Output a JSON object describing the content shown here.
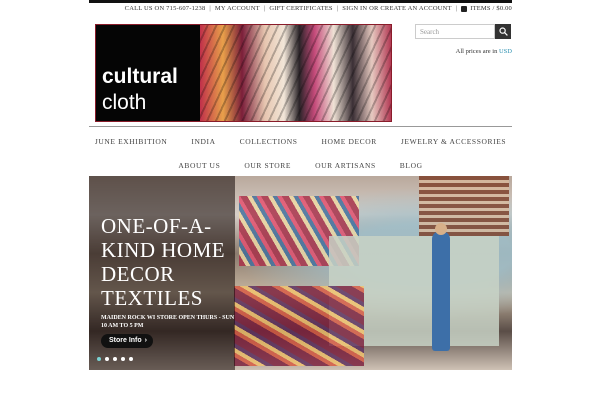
{
  "utility": {
    "phone": "CALL US ON 715-607-1238",
    "account": "MY ACCOUNT",
    "gift": "GIFT CERTIFICATES",
    "signin": "SIGN IN OR CREATE AN ACCOUNT",
    "cart": "ITEMS / $0.00"
  },
  "logo": {
    "line1": "cultural",
    "line2": "cloth"
  },
  "search": {
    "placeholder": "Search"
  },
  "prices": {
    "prefix": "All prices are in",
    "currency": "USD"
  },
  "nav": {
    "row1": [
      "JUNE EXHIBITION",
      "INDIA",
      "COLLECTIONS",
      "HOME DECOR",
      "JEWELRY & ACCESSORIES"
    ],
    "row2": [
      "ABOUT US",
      "OUR STORE",
      "OUR ARTISANS",
      "BLOG"
    ]
  },
  "hero": {
    "heading": "ONE-OF-A-KIND HOME DECOR TEXTILES",
    "sub": "MAIDEN ROCK WI STORE OPEN THURS - SUN 10 AM TO 5 PM",
    "button": "Store Info",
    "slides_total": 5,
    "active_slide": 1
  },
  "colors": {
    "accent": "#7ad3d3",
    "link": "#2a8fb0",
    "logo_border": "#8a1c2a"
  }
}
